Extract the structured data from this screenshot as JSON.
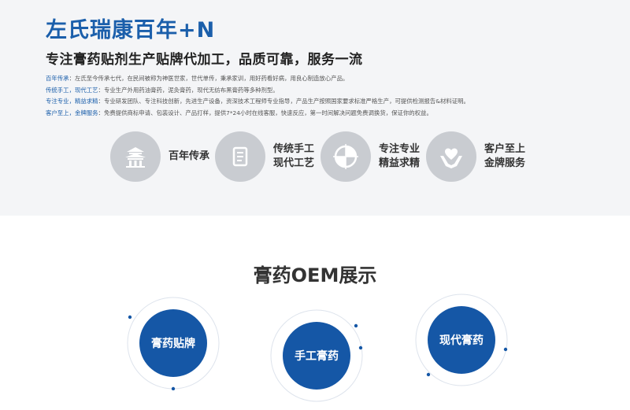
{
  "header": {
    "brand": "左氏瑞康百年+N",
    "headline": "专注膏药贴剂生产贴牌代加工，品质可靠，服务一流"
  },
  "descriptions": [
    {
      "key": "百年传承",
      "text": "左氏至今传承七代，在民间被称为神医世家，世代单传，秉承家训，用好药看好病，用良心制造放心产品。"
    },
    {
      "key": "传统手工，现代工艺",
      "text": "专业生产外用药油膏药，泥灸膏药，现代无纺布黑膏药等多种剂型。"
    },
    {
      "key": "专注专业，精益求精",
      "text": "专业研发团队、专注科技创新，先进生产设备，资深技术工程师专业指导，产品生产按照国家要求标准严格生产，可提供检测报告&材料证明。"
    },
    {
      "key": "客户至上，金牌服务",
      "text": "免费提供商标申请、包装设计、产品打样，提供7*24小时在线客服，快速反应，第一时间解决问题免费调换货，保证你的权益。"
    }
  ],
  "features": [
    {
      "icon": "temple-icon",
      "lines": [
        "百年传承"
      ]
    },
    {
      "icon": "scroll-icon",
      "lines": [
        "传统手工",
        "现代工艺"
      ]
    },
    {
      "icon": "target-icon",
      "lines": [
        "专注专业",
        "精益求精"
      ]
    },
    {
      "icon": "heart-hands-icon",
      "lines": [
        "客户至上",
        "金牌服务"
      ]
    }
  ],
  "oem_section": {
    "title": "膏药OEM展示",
    "items": [
      {
        "label": "膏药贴牌"
      },
      {
        "label": "手工膏药"
      },
      {
        "label": "现代膏药"
      }
    ]
  },
  "colors": {
    "accent": "#1b5fab",
    "circle": "#1557a6",
    "feature_bg": "#c9ccd1"
  }
}
